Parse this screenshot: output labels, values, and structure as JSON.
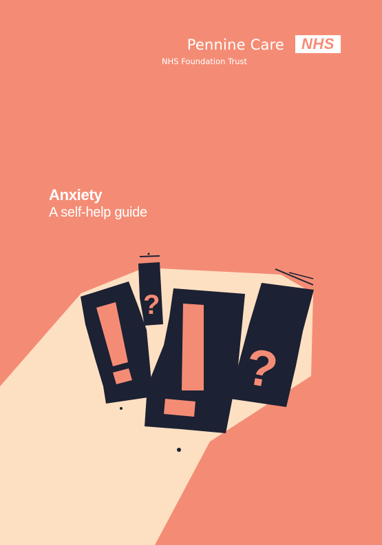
{
  "organisation": {
    "name": "Pennine Care",
    "logo_text": "NHS",
    "subtitle": "NHS Foundation Trust"
  },
  "cover": {
    "title": "Anxiety",
    "subtitle": "A self-help guide"
  },
  "colors": {
    "background": "#f48c75",
    "light_beam": "#fde0c2",
    "cards": "#1c2133",
    "symbols": "#f48c75",
    "text": "#ffffff"
  },
  "illustration": {
    "symbols": [
      "!",
      "?",
      "!",
      "?"
    ]
  }
}
